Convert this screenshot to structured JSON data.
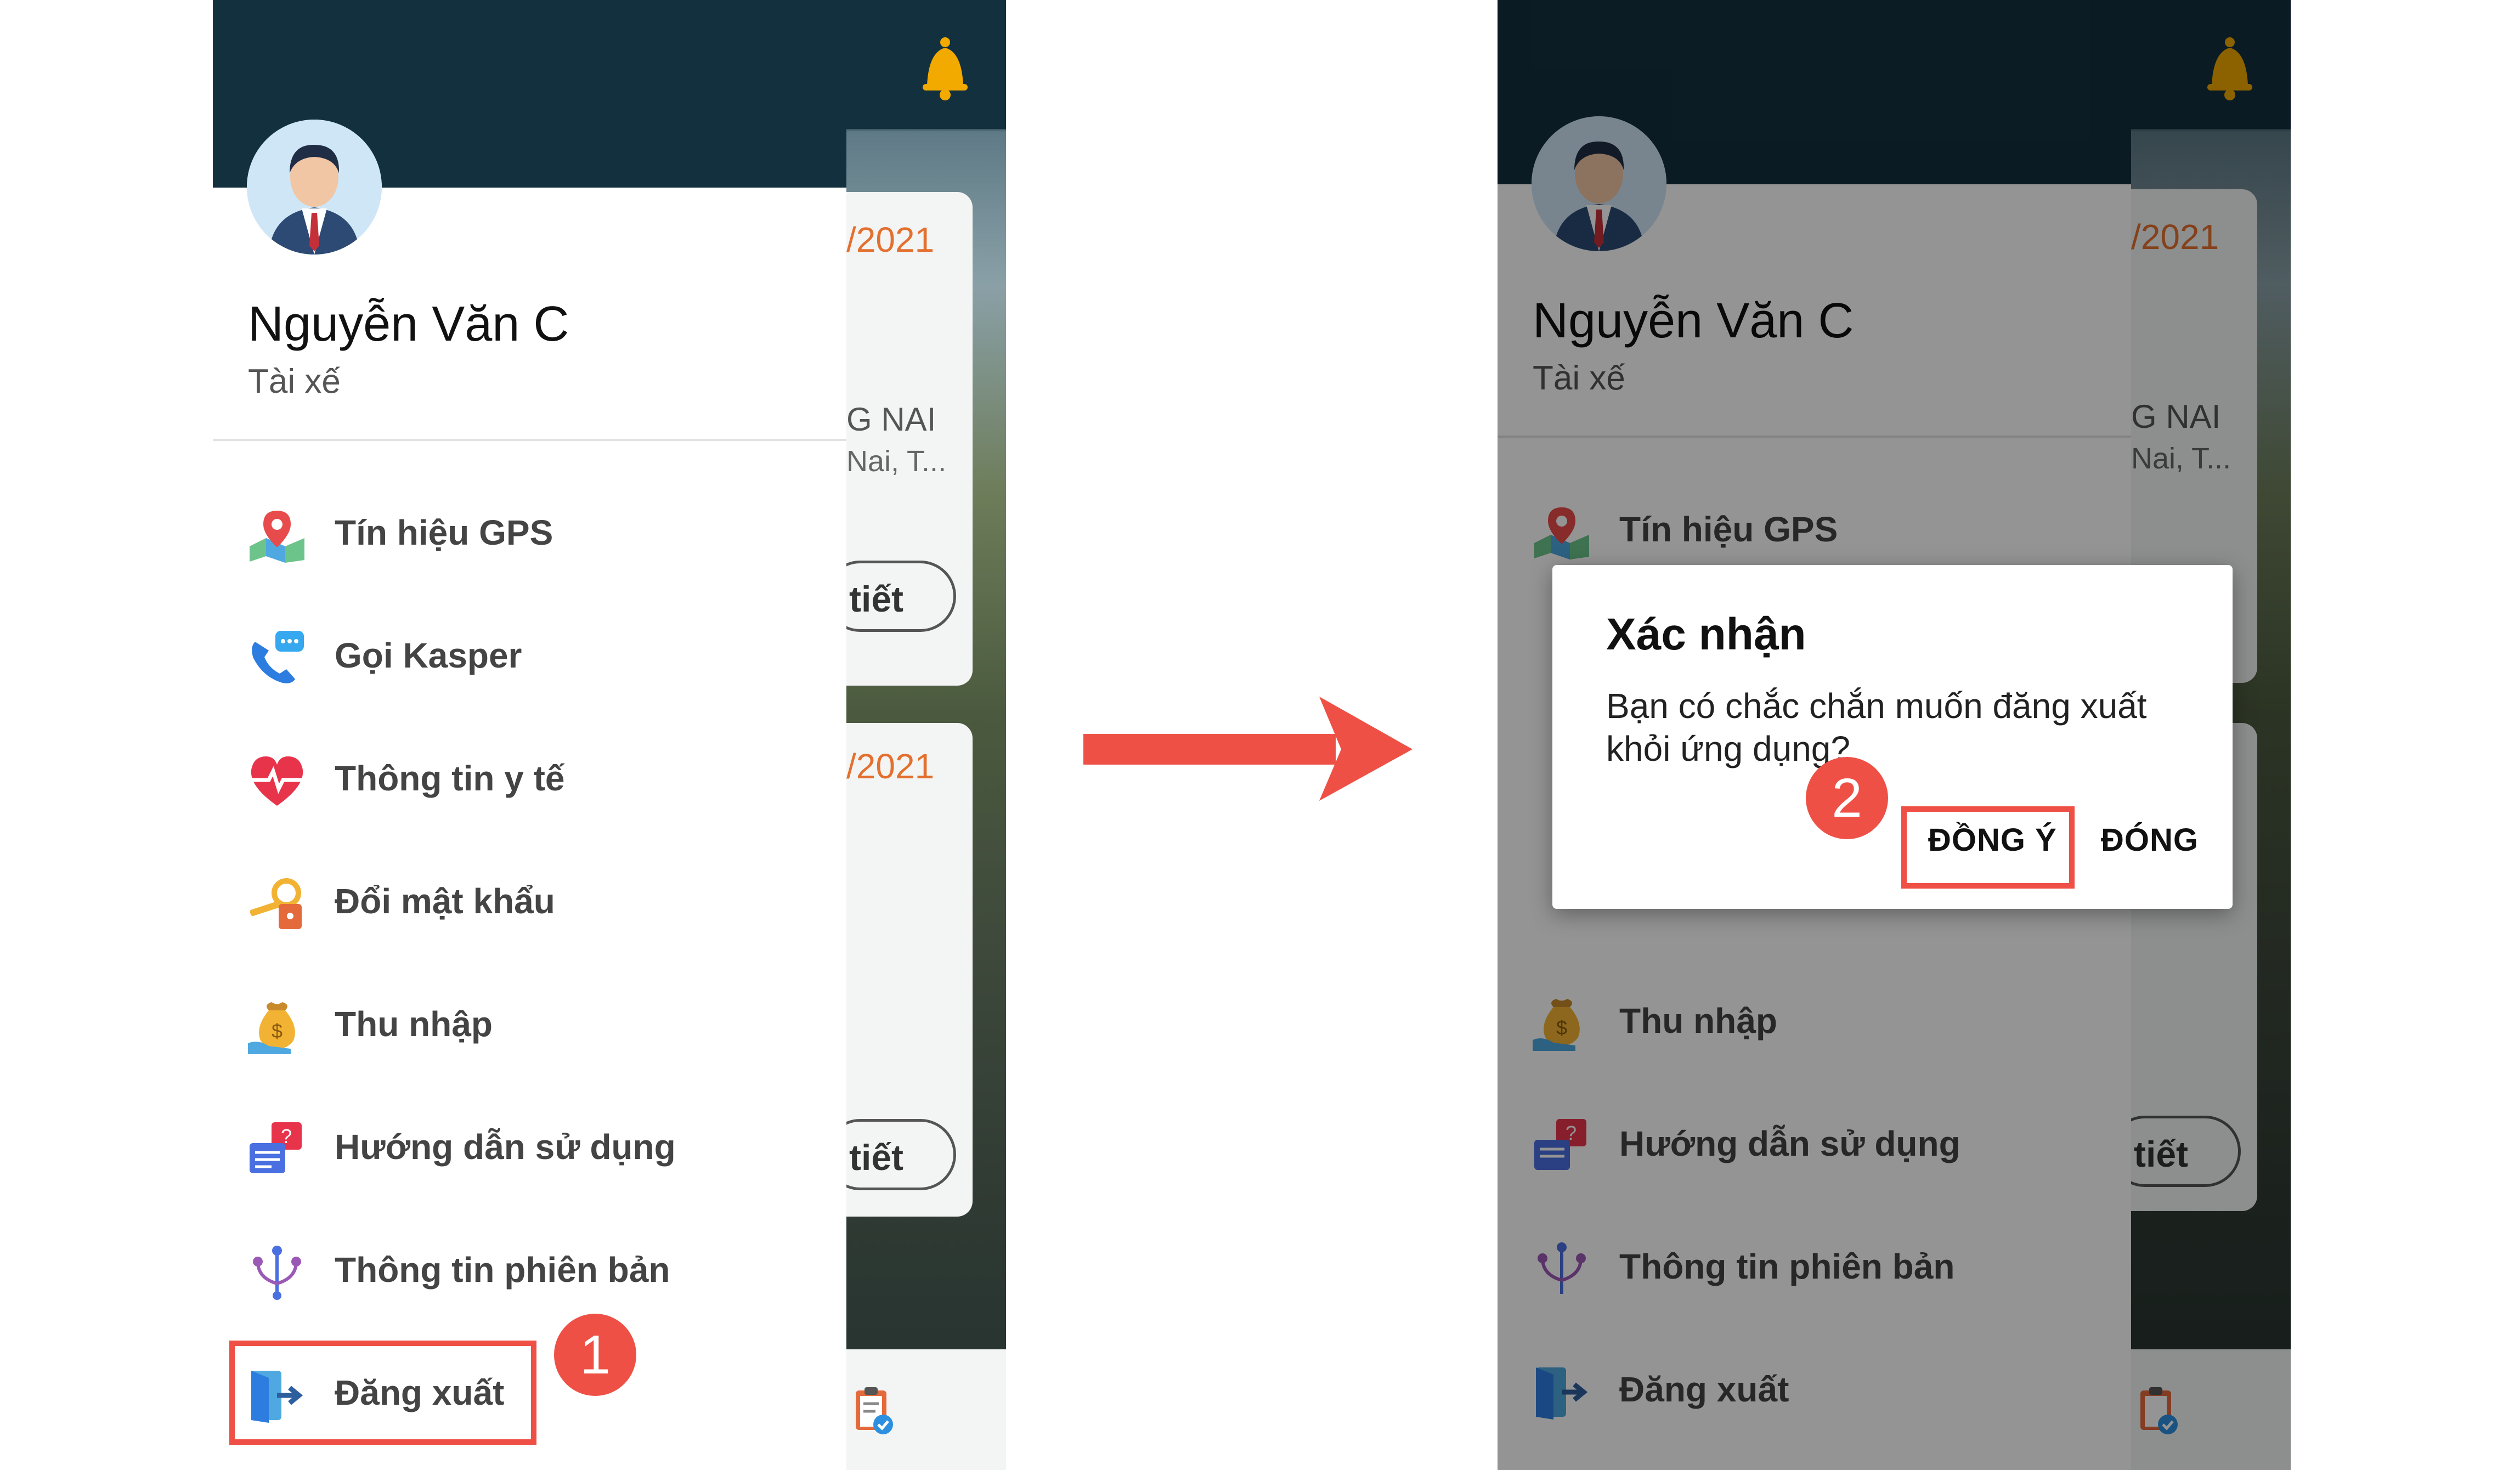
{
  "left_screen": {
    "user": {
      "name": "Nguyễn Văn C",
      "role": "Tài xế"
    },
    "menu": [
      {
        "label": "Tín hiệu GPS",
        "icon": "gps-map-icon"
      },
      {
        "label": "Gọi Kasper",
        "icon": "phone-chat-icon"
      },
      {
        "label": "Thông tin y tế",
        "icon": "heart-pulse-icon"
      },
      {
        "label": "Đổi mật khẩu",
        "icon": "key-lock-icon"
      },
      {
        "label": "Thu nhập",
        "icon": "money-bag-icon"
      },
      {
        "label": "Hướng dẫn sử dụng",
        "icon": "help-chat-icon"
      },
      {
        "label": "Thông tin phiên bản",
        "icon": "version-branch-icon"
      },
      {
        "label": "Đăng xuất",
        "icon": "logout-icon"
      }
    ],
    "background_cards": [
      {
        "date": "/2021",
        "location": "G NAI",
        "sub": "Nai, T...",
        "button": "tiết"
      },
      {
        "date": "/2021",
        "button": "tiết"
      }
    ],
    "step_badge": "1"
  },
  "right_screen": {
    "user": {
      "name": "Nguyễn Văn C",
      "role": "Tài xế"
    },
    "menu": [
      {
        "label": "Tín hiệu GPS"
      },
      {
        "label": "Thu nhập"
      },
      {
        "label": "Hướng dẫn sử dụng"
      },
      {
        "label": "Thông tin phiên bản"
      },
      {
        "label": "Đăng xuất"
      }
    ],
    "background_cards": [
      {
        "date": "/2021",
        "location": "G NAI",
        "sub": "Nai, T...",
        "button": "tiết"
      },
      {
        "button": "tiết"
      }
    ],
    "dialog": {
      "title": "Xác nhận",
      "message": "Bạn có chắc chắn muốn đăng xuất khỏi ứng dụng?",
      "confirm": "ĐỒNG Ý",
      "close": "ĐÓNG"
    },
    "step_badge": "2"
  },
  "colors": {
    "header": "#13303e",
    "highlight": "#ef5046",
    "date_orange": "#e3702f"
  }
}
